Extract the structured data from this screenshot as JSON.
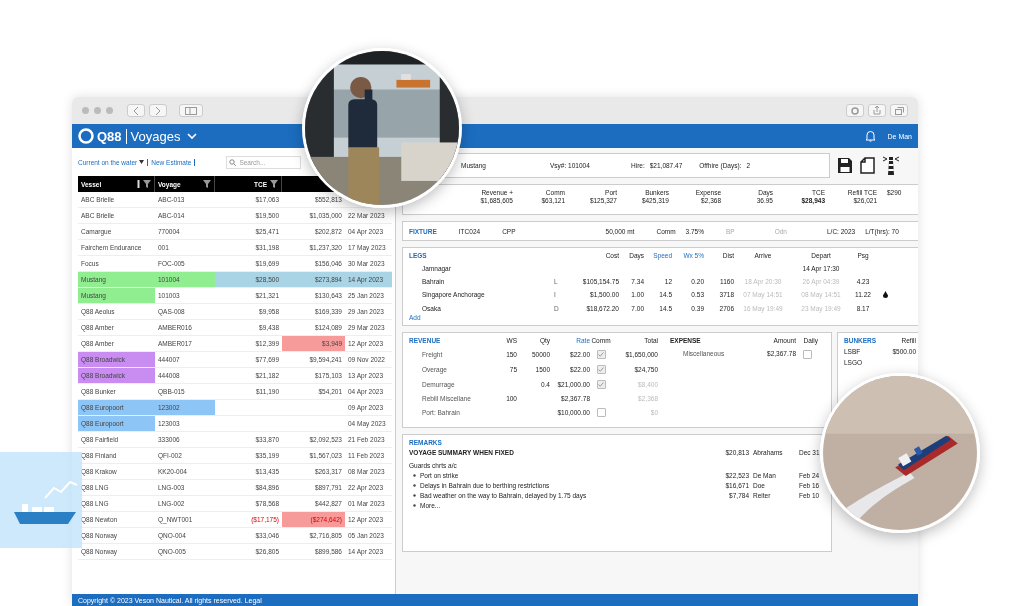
{
  "app": {
    "logo": "Q88",
    "title": "Voyages",
    "user": "De Man"
  },
  "toolbar": {
    "links": [
      {
        "label": "Current on the water",
        "dropdown": true
      },
      {
        "label": "New Estimate",
        "dropdown": false
      }
    ],
    "search": {
      "placeholder": "Search..."
    }
  },
  "table": {
    "columns": [
      {
        "label": "Vessel",
        "sort": true,
        "filter": true
      },
      {
        "label": "Voyage",
        "sort": false,
        "filter": true
      },
      {
        "label": "TCE",
        "sort": false,
        "filter": true
      }
    ],
    "rows": [
      {
        "selected": false,
        "cells": [
          {
            "text": "ABC Brielle"
          },
          {
            "text": "ABC-013"
          },
          {
            "text": "$17,063"
          },
          {
            "text": "$552,813"
          }
        ]
      },
      {
        "selected": false,
        "cells": [
          {
            "text": "ABC Brielle"
          },
          {
            "text": "ABC-014"
          },
          {
            "text": "$19,500"
          },
          {
            "text": "$1,035,000"
          },
          {
            "text": "22 Mar 2023"
          }
        ]
      },
      {
        "selected": false,
        "cells": [
          {
            "text": "Camargue"
          },
          {
            "text": "770004"
          },
          {
            "text": "$25,471"
          },
          {
            "text": "$202,872"
          },
          {
            "text": "04 Apr 2023"
          }
        ]
      },
      {
        "selected": false,
        "cells": [
          {
            "text": "Fairchem Endurance"
          },
          {
            "text": "001"
          },
          {
            "text": "$31,198"
          },
          {
            "text": "$1,237,320"
          },
          {
            "text": "17 May 2023"
          }
        ]
      },
      {
        "selected": false,
        "cells": [
          {
            "text": "Focus"
          },
          {
            "text": "FOC-005"
          },
          {
            "text": "$19,699"
          },
          {
            "text": "$156,046"
          },
          {
            "text": "30 Mar 2023"
          }
        ]
      },
      {
        "selected": true,
        "cells": [
          {
            "text": "Mustang",
            "color": "#90ee90"
          },
          {
            "text": "101004",
            "color": "#90ee90"
          },
          {
            "text": "$28,500"
          },
          {
            "text": "$273,894"
          },
          {
            "text": "14 Apr 2023"
          }
        ]
      },
      {
        "selected": false,
        "cells": [
          {
            "text": "Mustang",
            "color": "#90ee90"
          },
          {
            "text": "101003"
          },
          {
            "text": "$21,321"
          },
          {
            "text": "$130,643"
          },
          {
            "text": "25 Jan 2023"
          }
        ]
      },
      {
        "selected": false,
        "cells": [
          {
            "text": "Q88 Aeolus"
          },
          {
            "text": "QAS-008"
          },
          {
            "text": "$9,958"
          },
          {
            "text": "$169,339"
          },
          {
            "text": "29 Jan 2023"
          }
        ]
      },
      {
        "selected": false,
        "cells": [
          {
            "text": "Q88 Amber"
          },
          {
            "text": "AMBER016"
          },
          {
            "text": "$9,438"
          },
          {
            "text": "$124,089"
          },
          {
            "text": "29 Mar 2023"
          }
        ]
      },
      {
        "selected": false,
        "cells": [
          {
            "text": "Q88 Amber"
          },
          {
            "text": "AMBER017"
          },
          {
            "text": "$12,399"
          },
          {
            "text": "$3,949",
            "color": "#f79a9a"
          },
          {
            "text": "12 Apr 2023"
          }
        ]
      },
      {
        "selected": false,
        "cells": [
          {
            "text": "Q88 Broadwick",
            "color": "#c98df2"
          },
          {
            "text": "444007"
          },
          {
            "text": "$77,699"
          },
          {
            "text": "$9,594,241"
          },
          {
            "text": "09 Nov 2022"
          }
        ]
      },
      {
        "selected": false,
        "cells": [
          {
            "text": "Q88 Broadwick",
            "color": "#c98df2"
          },
          {
            "text": "444008"
          },
          {
            "text": "$21,182"
          },
          {
            "text": "$175,103"
          },
          {
            "text": "13 Apr 2023"
          }
        ]
      },
      {
        "selected": false,
        "cells": [
          {
            "text": "Q88 Bunker"
          },
          {
            "text": "QBB-015"
          },
          {
            "text": "$11,190"
          },
          {
            "text": "$54,201"
          },
          {
            "text": "04 Apr 2023"
          }
        ]
      },
      {
        "selected": false,
        "cells": [
          {
            "text": "Q88 Europoort",
            "color": "#8ec5f7"
          },
          {
            "text": "123002",
            "color": "#8ec5f7"
          },
          {},
          {},
          {
            "text": "09 Apr 2023"
          }
        ]
      },
      {
        "selected": false,
        "cells": [
          {
            "text": "Q88 Europoort",
            "color": "#8ec5f7"
          },
          {
            "text": "123003"
          },
          {},
          {},
          {
            "text": "04 May 2023"
          }
        ]
      },
      {
        "selected": false,
        "cells": [
          {
            "text": "Q88 Fairfield"
          },
          {
            "text": "333006"
          },
          {
            "text": "$33,870"
          },
          {
            "text": "$2,092,523"
          },
          {
            "text": "21 Feb 2023"
          }
        ]
      },
      {
        "selected": false,
        "cells": [
          {
            "text": "Q88 Finland"
          },
          {
            "text": "QFI-002"
          },
          {
            "text": "$35,199"
          },
          {
            "text": "$1,567,023"
          },
          {
            "text": "11 Feb 2023"
          }
        ]
      },
      {
        "selected": false,
        "cells": [
          {
            "text": "Q88 Krakow"
          },
          {
            "text": "KK20-004"
          },
          {
            "text": "$13,435"
          },
          {
            "text": "$263,317"
          },
          {
            "text": "08 Mar 2023"
          }
        ]
      },
      {
        "selected": false,
        "cells": [
          {
            "text": "Q88 LNG"
          },
          {
            "text": "LNG-003"
          },
          {
            "text": "$84,896"
          },
          {
            "text": "$897,791"
          },
          {
            "text": "22 Apr 2023"
          }
        ]
      },
      {
        "selected": false,
        "cells": [
          {
            "text": "Q88 LNG"
          },
          {
            "text": "LNG-002"
          },
          {
            "text": "$78,568"
          },
          {
            "text": "$442,827"
          },
          {
            "text": "01 Mar 2023"
          }
        ]
      },
      {
        "selected": false,
        "cells": [
          {
            "text": "Q88 Newton"
          },
          {
            "text": "Q_NWT001"
          },
          {
            "text": "($17,175)",
            "negative": true
          },
          {
            "text": "($274,642)",
            "negative": true,
            "color": "#f79a9a"
          },
          {
            "text": "12 Apr 2023"
          }
        ]
      },
      {
        "selected": false,
        "cells": [
          {
            "text": "Q88 Norway"
          },
          {
            "text": "QNO-004"
          },
          {
            "text": "$33,046"
          },
          {
            "text": "$2,716,805"
          },
          {
            "text": "05 Jan 2023"
          }
        ]
      },
      {
        "selected": false,
        "cells": [
          {
            "text": "Q88 Norway"
          },
          {
            "text": "QNO-005"
          },
          {
            "text": "$26,805"
          },
          {
            "text": "$899,586"
          },
          {
            "text": "14 Apr 2023"
          }
        ]
      }
    ]
  },
  "voyage": {
    "vessel": "Mustang",
    "voyage_no": "Vsy#: 101004",
    "hire_label": "Hire:",
    "hire": "$21,087.47",
    "offhire_label": "Offhire (Days):",
    "offhire": "2"
  },
  "summary": [
    {
      "label": "Revenue +",
      "value": "$1,685,605",
      "bold": false
    },
    {
      "label": "Comm",
      "value": "$63,121",
      "bold": false
    },
    {
      "label": "Port",
      "value": "$125,327",
      "bold": false
    },
    {
      "label": "Bunkers",
      "value": "$425,319",
      "bold": false
    },
    {
      "label": "Expense",
      "value": "$2,368",
      "bold": false
    },
    {
      "label": "Days",
      "value": "36.95",
      "bold": false
    },
    {
      "label": "TCE",
      "value": "$28,943",
      "bold": true
    },
    {
      "label": "Refill TCE",
      "value": "$26,021",
      "bold": false
    },
    {
      "value": "$290",
      "bold": false
    }
  ],
  "fixture": {
    "title": "FIXTURE",
    "items": [
      {
        "text": "ITC024",
        "muted": false
      },
      {
        "text": "CPP",
        "muted": false
      },
      {
        "text": "50,000 mt",
        "muted": false
      },
      {
        "text": "Comm",
        "muted": false
      },
      {
        "text": "3.75%",
        "muted": false
      },
      {
        "text": "BP",
        "muted": true
      },
      {
        "text": "Odn",
        "muted": true
      },
      {
        "text": "L/C: 2023",
        "muted": false
      },
      {
        "text": "L/T(hrs):  70",
        "muted": false
      }
    ]
  },
  "legs": {
    "title": "LEGS",
    "columns": [
      {
        "label": "Cost",
        "link": false
      },
      {
        "label": "Days",
        "link": false
      },
      {
        "label": "Speed",
        "link": true
      },
      {
        "label": "Wx 5%",
        "link": true
      },
      {
        "label": "Dist",
        "link": false
      },
      {
        "label": "Arrive",
        "link": false
      },
      {
        "label": "Depart",
        "link": false
      },
      {
        "label": "Psg",
        "link": false
      }
    ],
    "rows": [
      {
        "port": "Jamnagar",
        "depart": "14 Apr 17:30",
        "bunker_flag": false
      },
      {
        "port": "Bahrain",
        "type": "L",
        "cost": "$105,154.75",
        "days": "7.34",
        "speed": "12",
        "wx": "0.20",
        "dist": "1160",
        "arrive": "18 Apr 20:30",
        "depart": "26 Apr 04:39",
        "psg": "4.23",
        "bunker_flag": false
      },
      {
        "port": "Singapore Anchorage",
        "type": "I",
        "cost": "$1,500.00",
        "days": "1.00",
        "speed": "14.5",
        "wx": "0.53",
        "dist": "3718",
        "arrive": "07 May 14:51",
        "depart": "08 May 14:51",
        "psg": "11.22",
        "bunker_flag": true
      },
      {
        "port": "Osaka",
        "type": "D",
        "cost": "$18,672.20",
        "days": "7.00",
        "speed": "14.5",
        "wx": "0.39",
        "dist": "2706",
        "arrive": "16 May 19:49",
        "depart": "23 May 19:49",
        "psg": "8.17",
        "bunker_flag": false
      }
    ],
    "add": "Add"
  },
  "revenue": {
    "title": "REVENUE",
    "columns": [
      {
        "label": "WS",
        "link": false
      },
      {
        "label": "Qty",
        "link": false
      },
      {
        "label": "Rate",
        "link": true
      },
      {
        "label": "Comm",
        "link": false
      },
      {
        "label": "Total",
        "link": false
      }
    ],
    "rows": [
      {
        "name": "Freight",
        "ws": "150",
        "qty": "50000",
        "rate": "$22.00",
        "comm": true,
        "total": "$1,650,000",
        "muted": false
      },
      {
        "name": "Overage",
        "ws": "75",
        "qty": "1500",
        "rate": "$22.00",
        "comm": true,
        "total": "$24,750",
        "muted": false
      },
      {
        "name": "Demurrage",
        "qty": "0.4",
        "rate": "$21,000.00",
        "comm": true,
        "total": "$8,400",
        "muted": true
      },
      {
        "name": "Rebill Miscellane",
        "ws": "100",
        "rate": "$2,367.78",
        "total": "$2,368",
        "muted": true
      },
      {
        "name": "Port: Bahrain",
        "rate": "$10,000.00",
        "comm": false,
        "total": "$0",
        "muted": true
      }
    ]
  },
  "expense": {
    "title": "EXPENSE",
    "columns": [
      "Amount",
      "Daily"
    ],
    "rows": [
      {
        "name": "Miscellaneous",
        "amount": "$2,367.78",
        "daily": false
      }
    ]
  },
  "bunkers": {
    "title": "BUNKERS",
    "column": "Refill",
    "rows": [
      {
        "name": "LSBF",
        "refill": "$500.00"
      },
      {
        "name": "LSGO"
      }
    ]
  },
  "remarks": {
    "title": "REMARKS",
    "summary": {
      "text": "VOYAGE SUMMARY WHEN FIXED",
      "amount": "$20,813",
      "person": "Abrahams",
      "date": "Dec 31"
    },
    "note": "Guards chrts a/c",
    "items": [
      {
        "text": "Port on strike",
        "amount": "$22,523",
        "person": "De Man",
        "date": "Feb 24"
      },
      {
        "text": "Delays in Bahrain due to berthing restrictions",
        "amount": "$16,671",
        "person": "Doe",
        "date": "Feb 16"
      },
      {
        "text": "Bad weather on the way to Bahrain, delayed by 1.75 days",
        "amount": "$7,784",
        "person": "Reiter",
        "date": "Feb 10"
      },
      {
        "text": "More..."
      }
    ]
  },
  "footer": "Copyright © 2023 Veson Nautical. All rights reserved. Legal"
}
